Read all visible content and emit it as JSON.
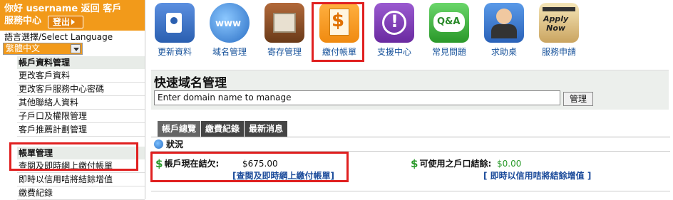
{
  "sidebar": {
    "welcome_line1": "你好    username    返回 客戶",
    "welcome_line2": "服務中心",
    "logout_label": "登出",
    "language_label": "語言選擇/Select Language",
    "language_value": "繁體中文",
    "account_group": "帳戶資料管理",
    "account_items": [
      "更改客戶資料",
      "更改客戶服務中心密碼",
      "其他聯絡人資料",
      "子戶口及權限管理",
      "客戶推薦計劃管理"
    ],
    "billing_group": "帳單管理",
    "billing_items": [
      "查閱及即時網上繳付帳單",
      "即時以信用咭將結餘增值",
      "繳費紀錄"
    ]
  },
  "toolbar": {
    "icons": [
      {
        "label": "更新資料",
        "icon": "contacts-book-icon",
        "color": "#2a5fb0"
      },
      {
        "label": "域名管理",
        "icon": "www-globe-icon",
        "color": "#2a6ec4"
      },
      {
        "label": "寄存管理",
        "icon": "server-box-icon",
        "color": "#8a4a22"
      },
      {
        "label": "繳付帳單",
        "icon": "dollar-invoice-icon",
        "color": "#f08a10"
      },
      {
        "label": "支援中心",
        "icon": "exclamation-icon",
        "color": "#7a3ab0"
      },
      {
        "label": "常見問題",
        "icon": "qa-bubble-icon",
        "color": "#3aa83a"
      },
      {
        "label": "求助桌",
        "icon": "helpdesk-agent-icon",
        "color": "#2a62b8"
      },
      {
        "label": "服務申請",
        "icon": "apply-now-notepad-icon",
        "color": "#caa460"
      }
    ]
  },
  "quick_domain": {
    "title": "快速域名管理",
    "input_value": "Enter domain name to manage",
    "button_label": "管理"
  },
  "tabs": [
    "帳戶總覽",
    "繳費紀錄",
    "最新消息"
  ],
  "status": {
    "heading": "狀況",
    "balance_label": "帳戶現在結欠:",
    "balance_amount": "$675.00",
    "balance_link": "[查閱及即時網上繳付帳單]",
    "subaccount_label": "可使用之戶口結餘:",
    "subaccount_amount": "$0.00",
    "subaccount_link": "[ 即時以信用咭將結餘增值 ]"
  }
}
